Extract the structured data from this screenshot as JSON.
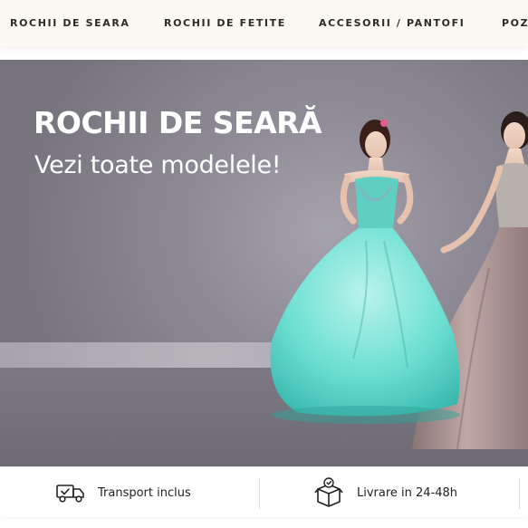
{
  "nav": {
    "items": [
      {
        "label": "ROCHII DE SEARA"
      },
      {
        "label": "ROCHII DE FETITE"
      },
      {
        "label": "ACCESORII / PANTOFI"
      },
      {
        "label": "POZ"
      }
    ]
  },
  "hero": {
    "title": "ROCHII DE SEARĂ",
    "subtitle": "Vezi toate modelele!"
  },
  "features": {
    "items": [
      {
        "label": "Transport inclus",
        "icon": "truck-icon"
      },
      {
        "label": "Livrare in 24-48h",
        "icon": "package-icon"
      }
    ]
  },
  "colors": {
    "nav_bg": "#fcf8f2",
    "hero_bg": "#8e8a95",
    "dress_turquoise": "#6fe0d4",
    "dress_taupe": "#a58f8f"
  }
}
